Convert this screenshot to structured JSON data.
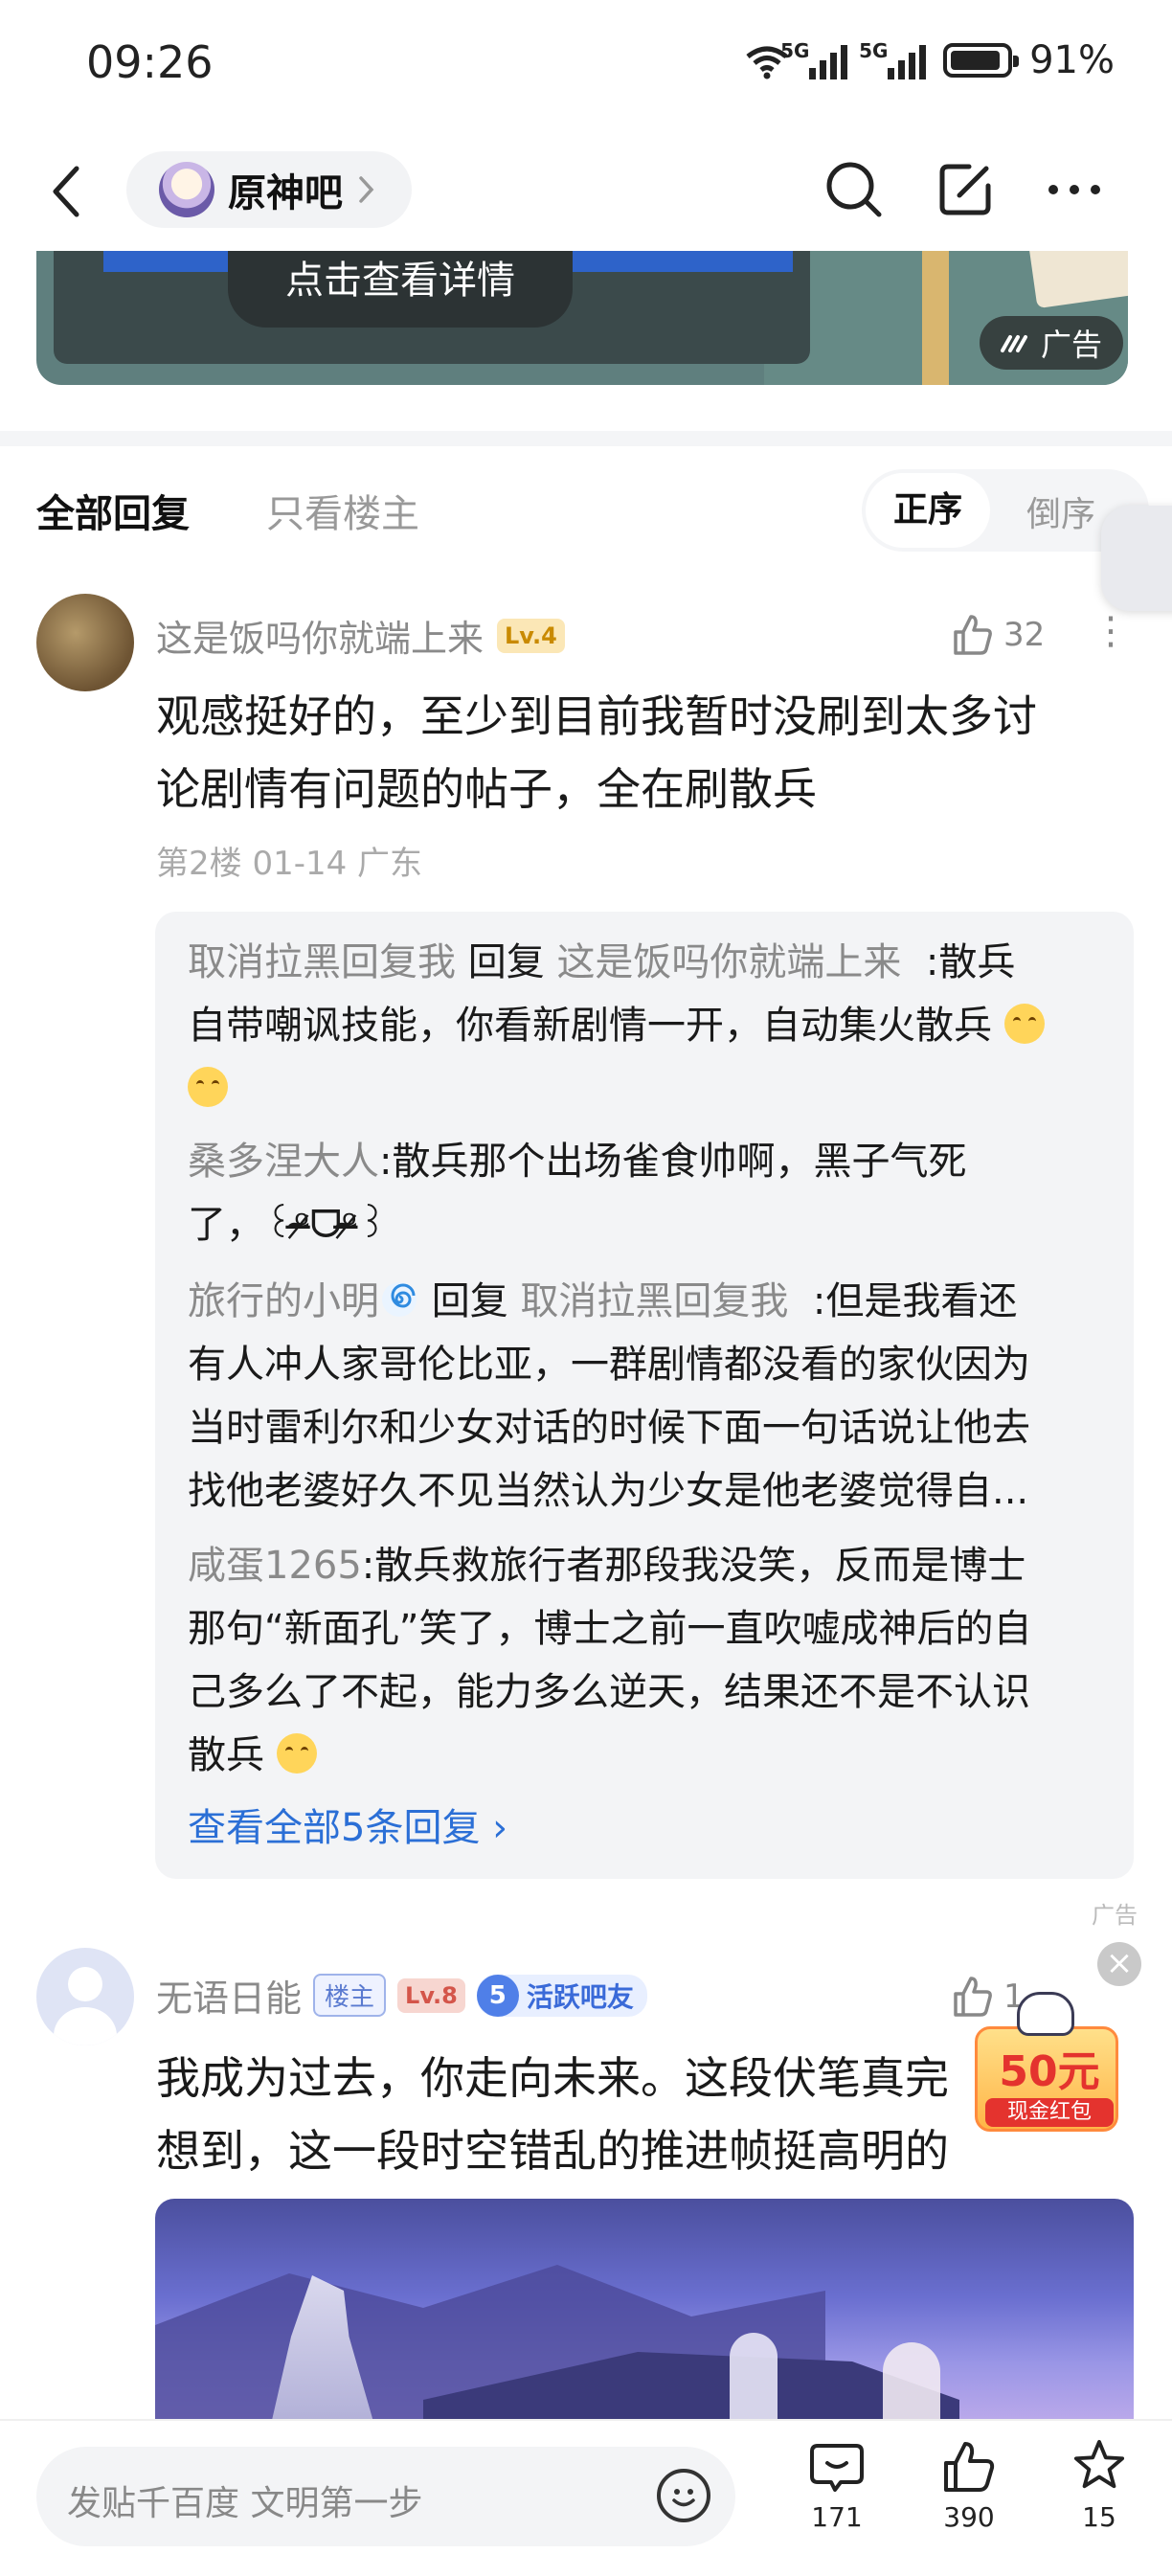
{
  "status_bar": {
    "time": "09:26",
    "signal1_tag": "5G",
    "signal2_tag": "5G",
    "battery": "91%",
    "battery_level": 0.91
  },
  "header": {
    "forum_name": "原神吧",
    "icons": [
      "back-icon",
      "search-icon",
      "edit-icon",
      "more-icon"
    ]
  },
  "ad_banner": {
    "cta": "点击查看详情",
    "badge": "广告"
  },
  "tabs": {
    "all": "全部回复",
    "owner_only": "只看楼主",
    "sort_asc": "正序",
    "sort_desc": "倒序"
  },
  "post1": {
    "username": "这是饭吗你就端上来",
    "level": "Lv.4",
    "likes": "32",
    "content_line1": "观感挺好的，至少到目前我暂时没刷到太多讨",
    "content_line2": "论剧情有问题的帖子，全在刷散兵",
    "meta": "第2楼 01-14 广东",
    "replies": [
      {
        "name": "取消拉黑回复我",
        "verb": "回复",
        "target": "这是饭吗你就端上来",
        "line1": ":散兵",
        "line2": "自带嘲讽技能，你看新剧情一开，自动集火散兵"
      },
      {
        "name": "桑多涅大人",
        "line1": ":散兵那个出场雀食帅啊，黑子气死",
        "line2": "了，꒰ᵒ̴̶̷ᗜᵒ̴̶̷꒱"
      },
      {
        "name": "旅行的小明",
        "verb": "回复",
        "target": "取消拉黑回复我",
        "line1": ":但是我看还",
        "line2": "有人冲人家哥伦比亚，一群剧情都没看的家伙因为",
        "line3": "当时雷利尔和少女对话的时候下面一句话说让他去",
        "line4": "找他老婆好久不见当然认为少女是他老婆觉得自..."
      },
      {
        "name": "咸蛋1265",
        "line1": ":散兵救旅行者那段我没笑，反而是博士",
        "line2": "那句“新面孔”笑了，博士之前一直吹嘘成神后的自",
        "line3": "己多么了不起，能力多么逆天，结果还不是不认识",
        "line4": "散兵"
      }
    ],
    "see_all": "查看全部5条回复 ›"
  },
  "ad_tag": "广告",
  "post2": {
    "username": "无语日能",
    "owner_tag": "楼主",
    "level": "Lv.8",
    "badge_num": "5",
    "badge_text": "活跃吧友",
    "likes": "1",
    "content_line1": "我成为过去，你走向未来。这段伏笔真完",
    "content_line2": "想到，这一段时空错乱的推进帧挺高明的"
  },
  "red_packet": {
    "amount": "50元",
    "label": "现金红包",
    "close": "×"
  },
  "bottom_bar": {
    "input_placeholder": "发贴千百度 文明第一步",
    "comments": "171",
    "likes": "390",
    "stars": "15"
  }
}
